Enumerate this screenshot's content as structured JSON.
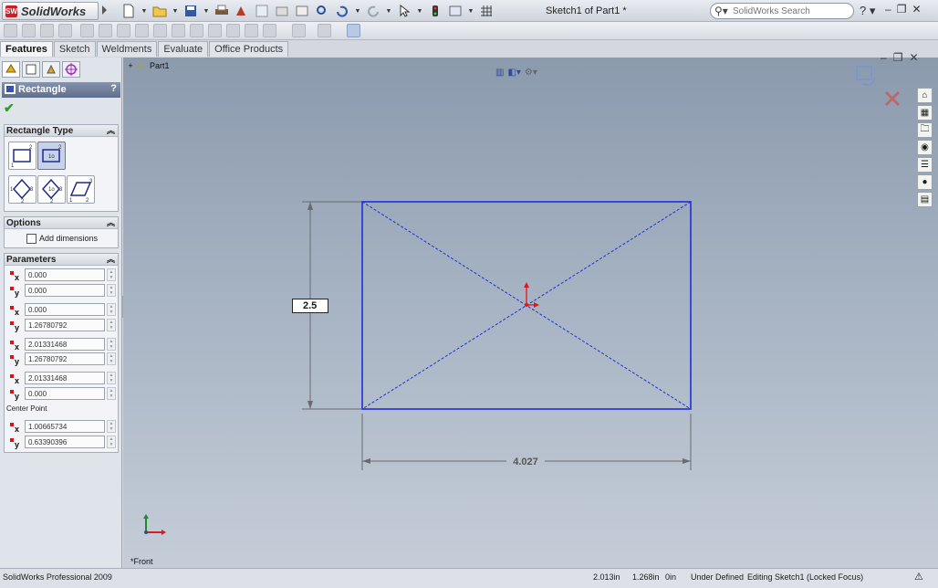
{
  "app": {
    "name": "SolidWorks",
    "logo_badge": "SW",
    "document_title": "Sketch1 of Part1 *",
    "search_placeholder": "SolidWorks Search",
    "help": "?"
  },
  "tabs": [
    {
      "label": "Features",
      "active": true
    },
    {
      "label": "Sketch",
      "active": false
    },
    {
      "label": "Weldments",
      "active": false
    },
    {
      "label": "Evaluate",
      "active": false
    },
    {
      "label": "Office Products",
      "active": false
    }
  ],
  "property_manager": {
    "title": "Rectangle",
    "help": "?",
    "ok_icon": "green-check-icon",
    "rectangle_type": {
      "heading": "Rectangle Type",
      "option_icons": [
        "corner-rectangle-icon",
        "center-rectangle-icon",
        "3-point-corner-rectangle-icon",
        "3-point-center-rectangle-icon",
        "parallelogram-icon"
      ],
      "selected_index": 1
    },
    "options": {
      "heading": "Options",
      "add_dimensions_label": "Add dimensions",
      "add_dimensions_checked": false
    },
    "parameters": {
      "heading": "Parameters",
      "points": [
        {
          "x": "0.000",
          "y": "0.000"
        },
        {
          "x": "0.000",
          "y": "1.26780792"
        },
        {
          "x": "2.01331468",
          "y": "1.26780792"
        },
        {
          "x": "2.01331468",
          "y": "0.000"
        }
      ],
      "center_point_label": "Center Point",
      "center": {
        "x": "1.00665734",
        "y": "0.63390396"
      },
      "axis_x": "x",
      "axis_y": "y"
    }
  },
  "graphics": {
    "tree_root": "Part1",
    "view_label": "*Front",
    "height_dimension_value": "2.5",
    "width_dimension_value": "4.027",
    "sketch_color": "#1f2fd6",
    "origin_color": "#e01818"
  },
  "status_bar": {
    "product": "SolidWorks Professional 2009",
    "x": "2.013in",
    "y": "1.268in",
    "z": "0in",
    "state": "Under Defined",
    "mode": "Editing Sketch1 (Locked Focus)"
  }
}
